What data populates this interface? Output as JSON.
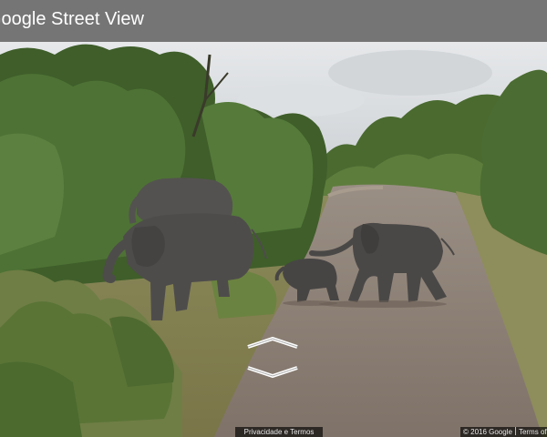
{
  "header": {
    "title": "Google Street View"
  },
  "navigation": {
    "forward_arrow_icon": "chevron-up-icon",
    "backward_arrow_icon": "chevron-down-icon"
  },
  "footer": {
    "privacy_terms": "Privacidade e Termos",
    "copyright": "© 2016 Google",
    "terms_of_use": "Terms of U"
  },
  "colors": {
    "titlebar": "#757575",
    "sky": "#d9dde0",
    "foliage": "#4d6b34",
    "road": "#8c7f72",
    "elephant": "#4f4d4c"
  }
}
